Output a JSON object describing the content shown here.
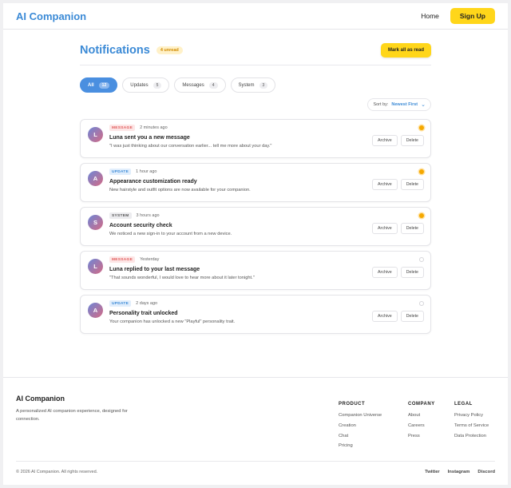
{
  "header": {
    "brand": "AI Companion",
    "home_label": "Home",
    "signup_label": "Sign Up"
  },
  "page": {
    "title": "Notifications",
    "unread_badge": "4 unread",
    "mark_all_label": "Mark all as read"
  },
  "filters": [
    {
      "label": "All",
      "count": "12",
      "active": true
    },
    {
      "label": "Updates",
      "count": "5",
      "active": false
    },
    {
      "label": "Messages",
      "count": "4",
      "active": false
    },
    {
      "label": "System",
      "count": "3",
      "active": false
    }
  ],
  "sort": {
    "label": "Sort by:",
    "value": "Newest First"
  },
  "notifications": [
    {
      "initial": "L",
      "type": "MESSAGE",
      "time": "2 minutes ago",
      "title": "Luna sent you a new message",
      "body": "\"I was just thinking about our conversation earlier... tell me more about your day.\"",
      "unread": true
    },
    {
      "initial": "A",
      "type": "UPDATE",
      "time": "1 hour ago",
      "title": "Appearance customization ready",
      "body": "New hairstyle and outfit options are now available for your companion.",
      "unread": true
    },
    {
      "initial": "S",
      "type": "SYSTEM",
      "time": "3 hours ago",
      "title": "Account security check",
      "body": "We noticed a new sign-in to your account from a new device.",
      "unread": true
    },
    {
      "initial": "L",
      "type": "MESSAGE",
      "time": "Yesterday",
      "title": "Luna replied to your last message",
      "body": "\"That sounds wonderful, I would love to hear more about it later tonight.\"",
      "unread": false
    },
    {
      "initial": "A",
      "type": "UPDATE",
      "time": "2 days ago",
      "title": "Personality trait unlocked",
      "body": "Your companion has unlocked a new \"Playful\" personality trait.",
      "unread": false
    }
  ],
  "actions": {
    "archive_label": "Archive",
    "delete_label": "Delete"
  },
  "footer": {
    "brand": "AI Companion",
    "desc": "A personalized AI companion experience, designed for connection.",
    "columns": [
      {
        "heading": "PRODUCT",
        "links": [
          "Companion Universe",
          "Creation",
          "Chat",
          "Pricing"
        ]
      },
      {
        "heading": "COMPANY",
        "links": [
          "About",
          "Careers",
          "Press"
        ]
      },
      {
        "heading": "LEGAL",
        "links": [
          "Privacy Policy",
          "Terms of Service",
          "Data Protection"
        ]
      }
    ],
    "copyright": "© 2026 AI Companion. All rights reserved.",
    "social": [
      "Twitter",
      "Instagram",
      "Discord"
    ]
  },
  "colors": {
    "brand_blue": "#3b8ad6",
    "accent_yellow": "#ffd61a",
    "unread_dot": "#f5a800"
  }
}
